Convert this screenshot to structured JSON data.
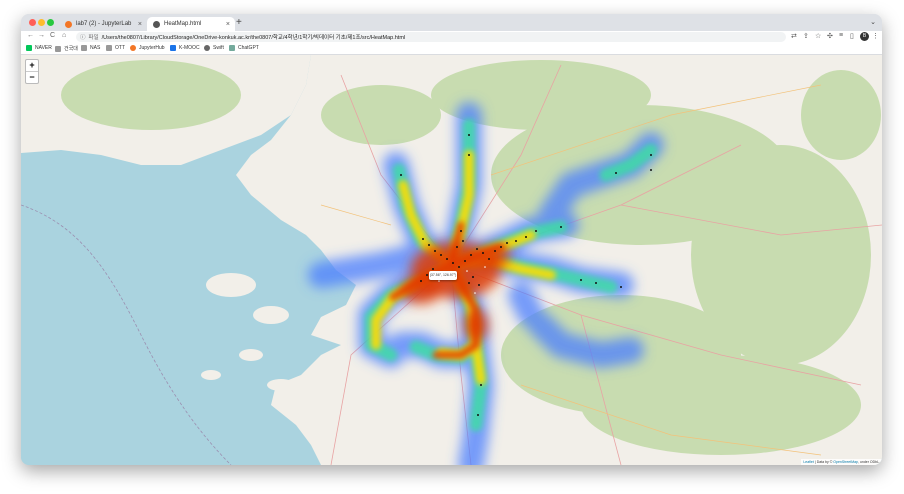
{
  "window": {
    "tabs": [
      {
        "title": "lab7 (2) - JupyterLab",
        "close": "×"
      },
      {
        "title": "HeatMap.html",
        "close": "×"
      }
    ],
    "new_tab": "+",
    "tab_menu": "⌄"
  },
  "toolbar": {
    "back": "←",
    "forward": "→",
    "reload": "C",
    "home": "⌂",
    "address_info": "ⓘ",
    "address_scheme": "파일",
    "address": "/Users/the0807/Library/CloudStorage/OneDrive-konkuk.ac.kr/the0807/학교/4학년/1학기/빅데이터 기초/제1조/src/HeatMap.html",
    "profile_initial": "B"
  },
  "bookmarks": [
    {
      "label": "NAVER",
      "icon": "naver-icon",
      "color": "#03c75a"
    },
    {
      "label": "건국대",
      "icon": "folder-icon",
      "color": "#888888"
    },
    {
      "label": "NAS",
      "icon": "folder-icon",
      "color": "#888888"
    },
    {
      "label": "OTT",
      "icon": "folder-icon",
      "color": "#888888"
    },
    {
      "label": "JupyterHub",
      "icon": "jupyter-icon",
      "color": "#f37626"
    },
    {
      "label": "K-MOOC",
      "icon": "kmooc-icon",
      "color": "#1a73e8"
    },
    {
      "label": "Swift",
      "icon": "swift-icon",
      "color": "#555555"
    },
    {
      "label": "ChatGPT",
      "icon": "chatgpt-icon",
      "color": "#74aa9c"
    }
  ],
  "map": {
    "zoom_in": "+",
    "zoom_out": "−",
    "popup": "(37.56°, 126.97°)",
    "attribution_leaflet": "Leaflet",
    "attribution_text": " | Data by © ",
    "attribution_osm": "OpenStreetMap",
    "attribution_license": ", under ODbL."
  },
  "colors": {
    "sea": "#aad3df",
    "land": "#f2efe9",
    "forest": "#c8dcb0",
    "heat_core": "#e03a00",
    "heat_mid": "#ffdd00",
    "heat_edge": "#4a7dff"
  }
}
